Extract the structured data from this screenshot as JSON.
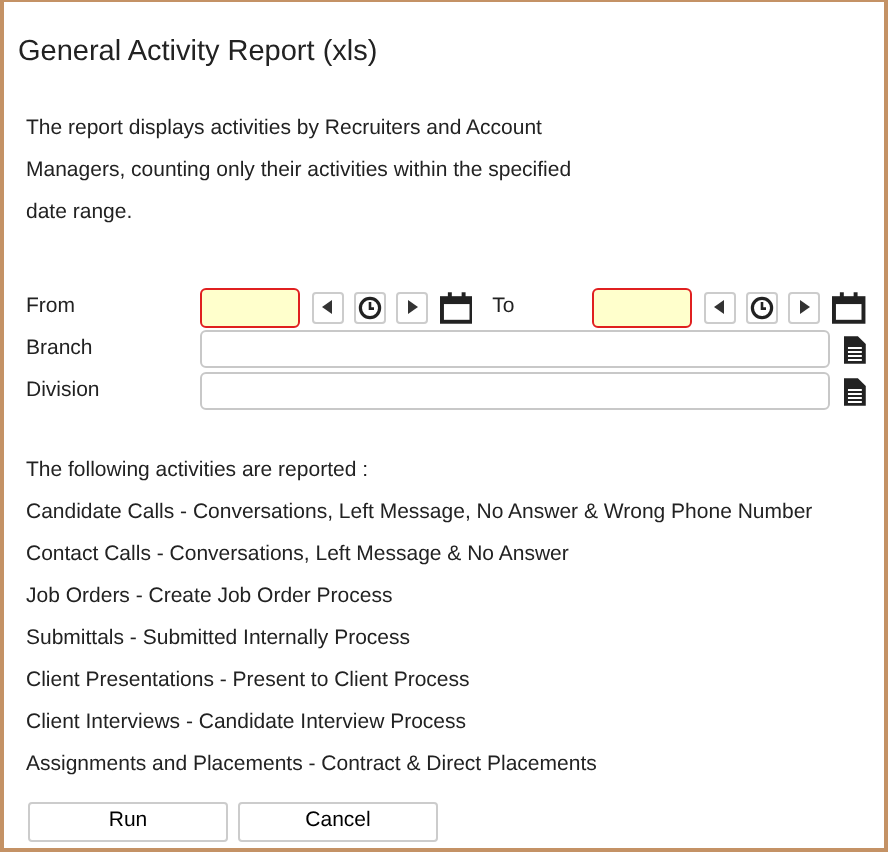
{
  "window": {
    "title": "General Activity Report (xls)"
  },
  "description": "The report displays activities by Recruiters and Account Managers, counting only their activities within the specified date range.",
  "date_range": {
    "from": {
      "label": "From",
      "invalid": true
    },
    "to": {
      "label": "To",
      "invalid": true
    }
  },
  "fields": [
    {
      "label": "Branch"
    },
    {
      "label": "Division"
    }
  ],
  "activities_heading": "The following activities are reported :",
  "activities": [
    "Candidate Calls - Conversations, Left Message, No Answer & Wrong Phone Number",
    "Contact Calls - Conversations, Left Message & No Answer",
    "Job Orders - Create Job Order Process",
    "Submittals - Submitted Internally Process",
    "Client Presentations - Present to Client Process",
    "Client Interviews - Candidate Interview Process",
    "Assignments and Placements - Contract & Direct Placements"
  ],
  "buttons": [
    "Run",
    "Cancel"
  ]
}
